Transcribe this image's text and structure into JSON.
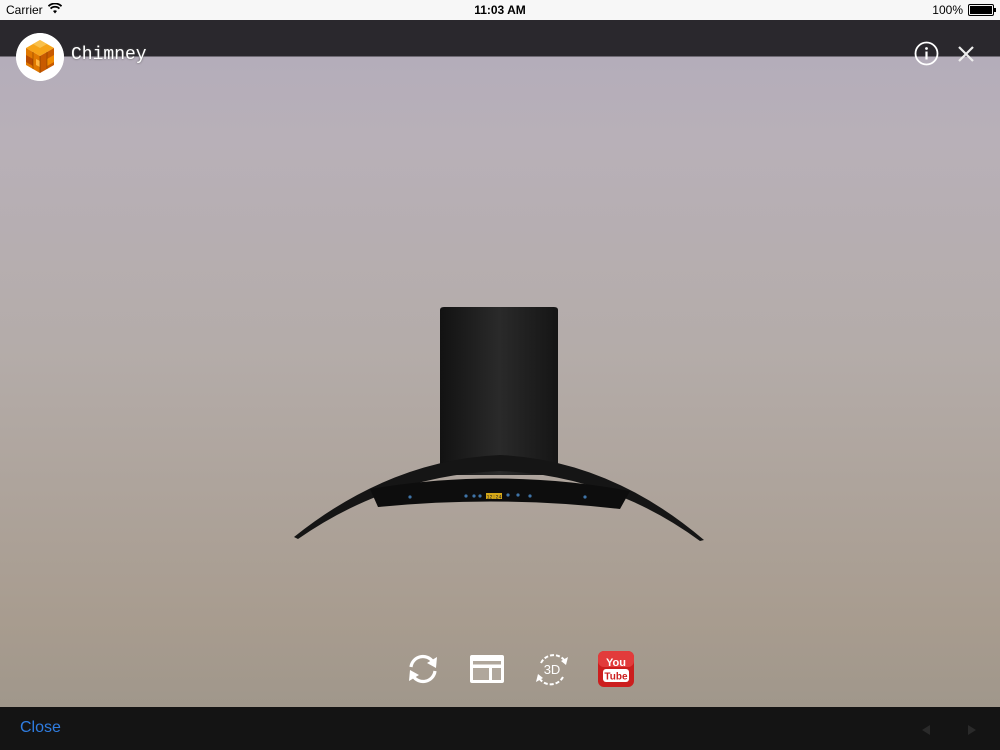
{
  "status_bar": {
    "carrier": "Carrier",
    "time": "11:03 AM",
    "battery": "100%"
  },
  "header": {
    "title": "Chimney",
    "logo_icon": "cube-logo-icon",
    "info_icon": "info-icon",
    "close_icon": "close-icon"
  },
  "model": {
    "display_text": "12:24"
  },
  "toolbar": {
    "items": [
      {
        "icon": "rotate-icon"
      },
      {
        "icon": "layout-icon"
      },
      {
        "icon": "3d-view-icon",
        "label": "3D"
      },
      {
        "icon": "youtube-icon",
        "label_top": "You",
        "label_bottom": "Tube"
      }
    ]
  },
  "bottom_bar": {
    "close_label": "Close",
    "prev_icon": "previous-arrow-icon",
    "next_icon": "next-arrow-icon"
  },
  "colors": {
    "link": "#2f7de1",
    "youtube_red": "#cc1e1e",
    "logo_orange": "#f08a00"
  }
}
